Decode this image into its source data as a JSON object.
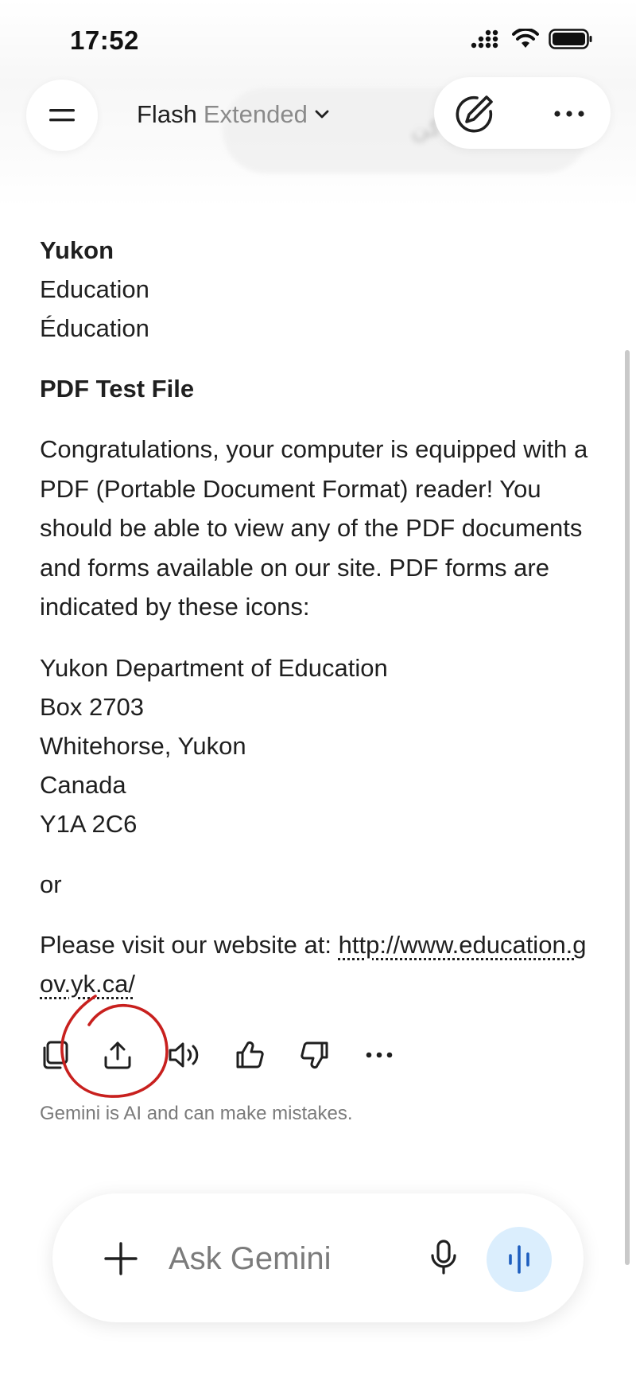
{
  "status": {
    "time": "17:52"
  },
  "header": {
    "model_name": "Flash",
    "model_variant": "Extended",
    "ghost_prompt": "تبدیل به متن کن"
  },
  "response": {
    "logo_title": "Yukon",
    "logo_line2": "Education",
    "logo_line3": "Éducation",
    "doc_title": "PDF Test File",
    "paragraph": "Congratulations, your computer is equipped with a PDF (Portable Document Format) reader! You should be able to view any of the PDF documents and forms available on our site. PDF forms are indicated by these icons:",
    "address": [
      "Yukon Department of Education",
      "Box 2703",
      "Whitehorse, Yukon",
      "Canada",
      "Y1A 2C6"
    ],
    "or_text": "or",
    "visit_prefix": "Please visit our website at: ",
    "link_text": "http://www.education.gov.yk.ca/"
  },
  "actions": [
    "copy-icon",
    "share-icon",
    "read-aloud-icon",
    "thumbs-up-icon",
    "thumbs-down-icon",
    "more-icon"
  ],
  "disclaimer": "Gemini is AI and can make mistakes.",
  "input": {
    "placeholder": "Ask Gemini"
  },
  "colors": {
    "accent_live": "#dbeefd",
    "annotation": "#c8201e"
  }
}
